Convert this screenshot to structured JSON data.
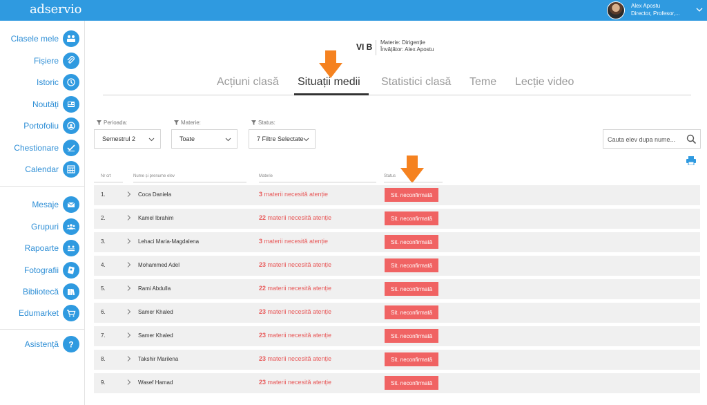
{
  "app": {
    "logo": "adservio"
  },
  "user": {
    "name": "Alex Apostu",
    "role": "Director, Profesor,..."
  },
  "sidebar": {
    "items": [
      {
        "label": "Clasele mele",
        "icon": "class-icon"
      },
      {
        "label": "Fișiere",
        "icon": "paperclip-icon"
      },
      {
        "label": "Istoric",
        "icon": "history-icon"
      },
      {
        "label": "Noutăți",
        "icon": "news-icon"
      },
      {
        "label": "Portofoliu",
        "icon": "portfolio-icon"
      },
      {
        "label": "Chestionare",
        "icon": "quiz-icon"
      },
      {
        "label": "Calendar",
        "icon": "calendar-icon"
      },
      {
        "label": "Mesaje",
        "icon": "mail-icon"
      },
      {
        "label": "Grupuri",
        "icon": "groups-icon"
      },
      {
        "label": "Rapoarte",
        "icon": "reports-icon"
      },
      {
        "label": "Fotografii",
        "icon": "photos-icon"
      },
      {
        "label": "Bibliotecă",
        "icon": "library-icon"
      },
      {
        "label": "Edumarket",
        "icon": "cart-icon"
      },
      {
        "label": "Asistență",
        "icon": "help-icon"
      }
    ]
  },
  "class_info": {
    "name": "VI B",
    "subject": "Materie: Dirigenție",
    "teacher": "Învățător: Alex Apostu"
  },
  "tabs": [
    {
      "label": "Acțiuni clasă",
      "active": false
    },
    {
      "label": "Situații medii",
      "active": true
    },
    {
      "label": "Statistici clasă",
      "active": false
    },
    {
      "label": "Teme",
      "active": false
    },
    {
      "label": "Lecție video",
      "active": false
    }
  ],
  "filters": {
    "period": {
      "label": "Perioada:",
      "value": "Semestrul 2"
    },
    "subject": {
      "label": "Materie:",
      "value": "Toate"
    },
    "status": {
      "label": "Status:",
      "value": "7 Filtre Selectate"
    }
  },
  "search": {
    "placeholder": "Cauta elev dupa nume..."
  },
  "table": {
    "headers": {
      "nr": "Nr crt",
      "name": "Nume și prenume elev",
      "subject": "Materie",
      "status": "Status"
    },
    "rows": [
      {
        "nr": "1.",
        "name": "Coca Daniela",
        "count": "3",
        "subject_text": " materii necesită atenție",
        "status": "Sit. neconfirmată"
      },
      {
        "nr": "2.",
        "name": "Kamel Ibrahim",
        "count": "22",
        "subject_text": " materii necesită atenție",
        "status": "Sit. neconfirmată"
      },
      {
        "nr": "3.",
        "name": "Lehaci Maria-Magdalena",
        "count": "3",
        "subject_text": " materii necesită atenție",
        "status": "Sit. neconfirmată"
      },
      {
        "nr": "4.",
        "name": "Mohammed Adel",
        "count": "23",
        "subject_text": " materii necesită atenție",
        "status": "Sit. neconfirmată"
      },
      {
        "nr": "5.",
        "name": "Rami Abdulla",
        "count": "22",
        "subject_text": " materii necesită atenție",
        "status": "Sit. neconfirmată"
      },
      {
        "nr": "6.",
        "name": "Samer Khaled",
        "count": "23",
        "subject_text": " materii necesită atenție",
        "status": "Sit. neconfirmată"
      },
      {
        "nr": "7.",
        "name": "Samer Khaled",
        "count": "23",
        "subject_text": " materii necesită atenție",
        "status": "Sit. neconfirmată"
      },
      {
        "nr": "8.",
        "name": "Takshir Marilena",
        "count": "23",
        "subject_text": " materii necesită atenție",
        "status": "Sit. neconfirmată"
      },
      {
        "nr": "9.",
        "name": "Wasef Hamad",
        "count": "23",
        "subject_text": " materii necesită atenție",
        "status": "Sit. neconfirmată"
      }
    ]
  },
  "colors": {
    "brand": "#2f9ae0",
    "alert": "#e85a5a",
    "badge": "#f06363",
    "arrow": "#f58220"
  }
}
